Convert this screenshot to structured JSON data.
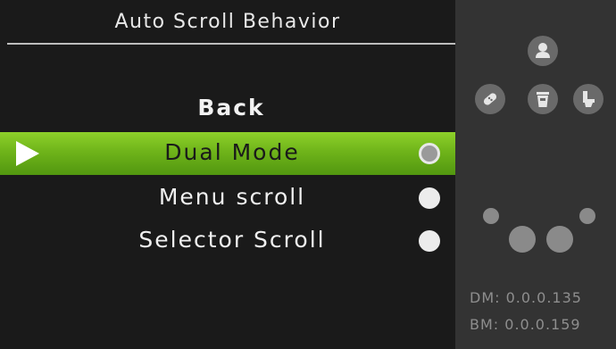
{
  "menu": {
    "title": "Auto Scroll Behavior",
    "back_label": "Back",
    "items": [
      {
        "label": "Dual Mode",
        "selected": true
      },
      {
        "label": "Menu scroll",
        "selected": false
      },
      {
        "label": "Selector Scroll",
        "selected": false
      }
    ]
  },
  "status": {
    "icons": [
      "person-icon",
      "bandage-icon",
      "trash-bin-icon",
      "toilet-icon"
    ],
    "dm_version": "DM:  0.0.0.135",
    "bm_version": "BM:  0.0.0.159"
  },
  "colors": {
    "accent_green": "#6fb41a",
    "panel_bg": "#1a1a1a",
    "side_bg": "#333333"
  }
}
